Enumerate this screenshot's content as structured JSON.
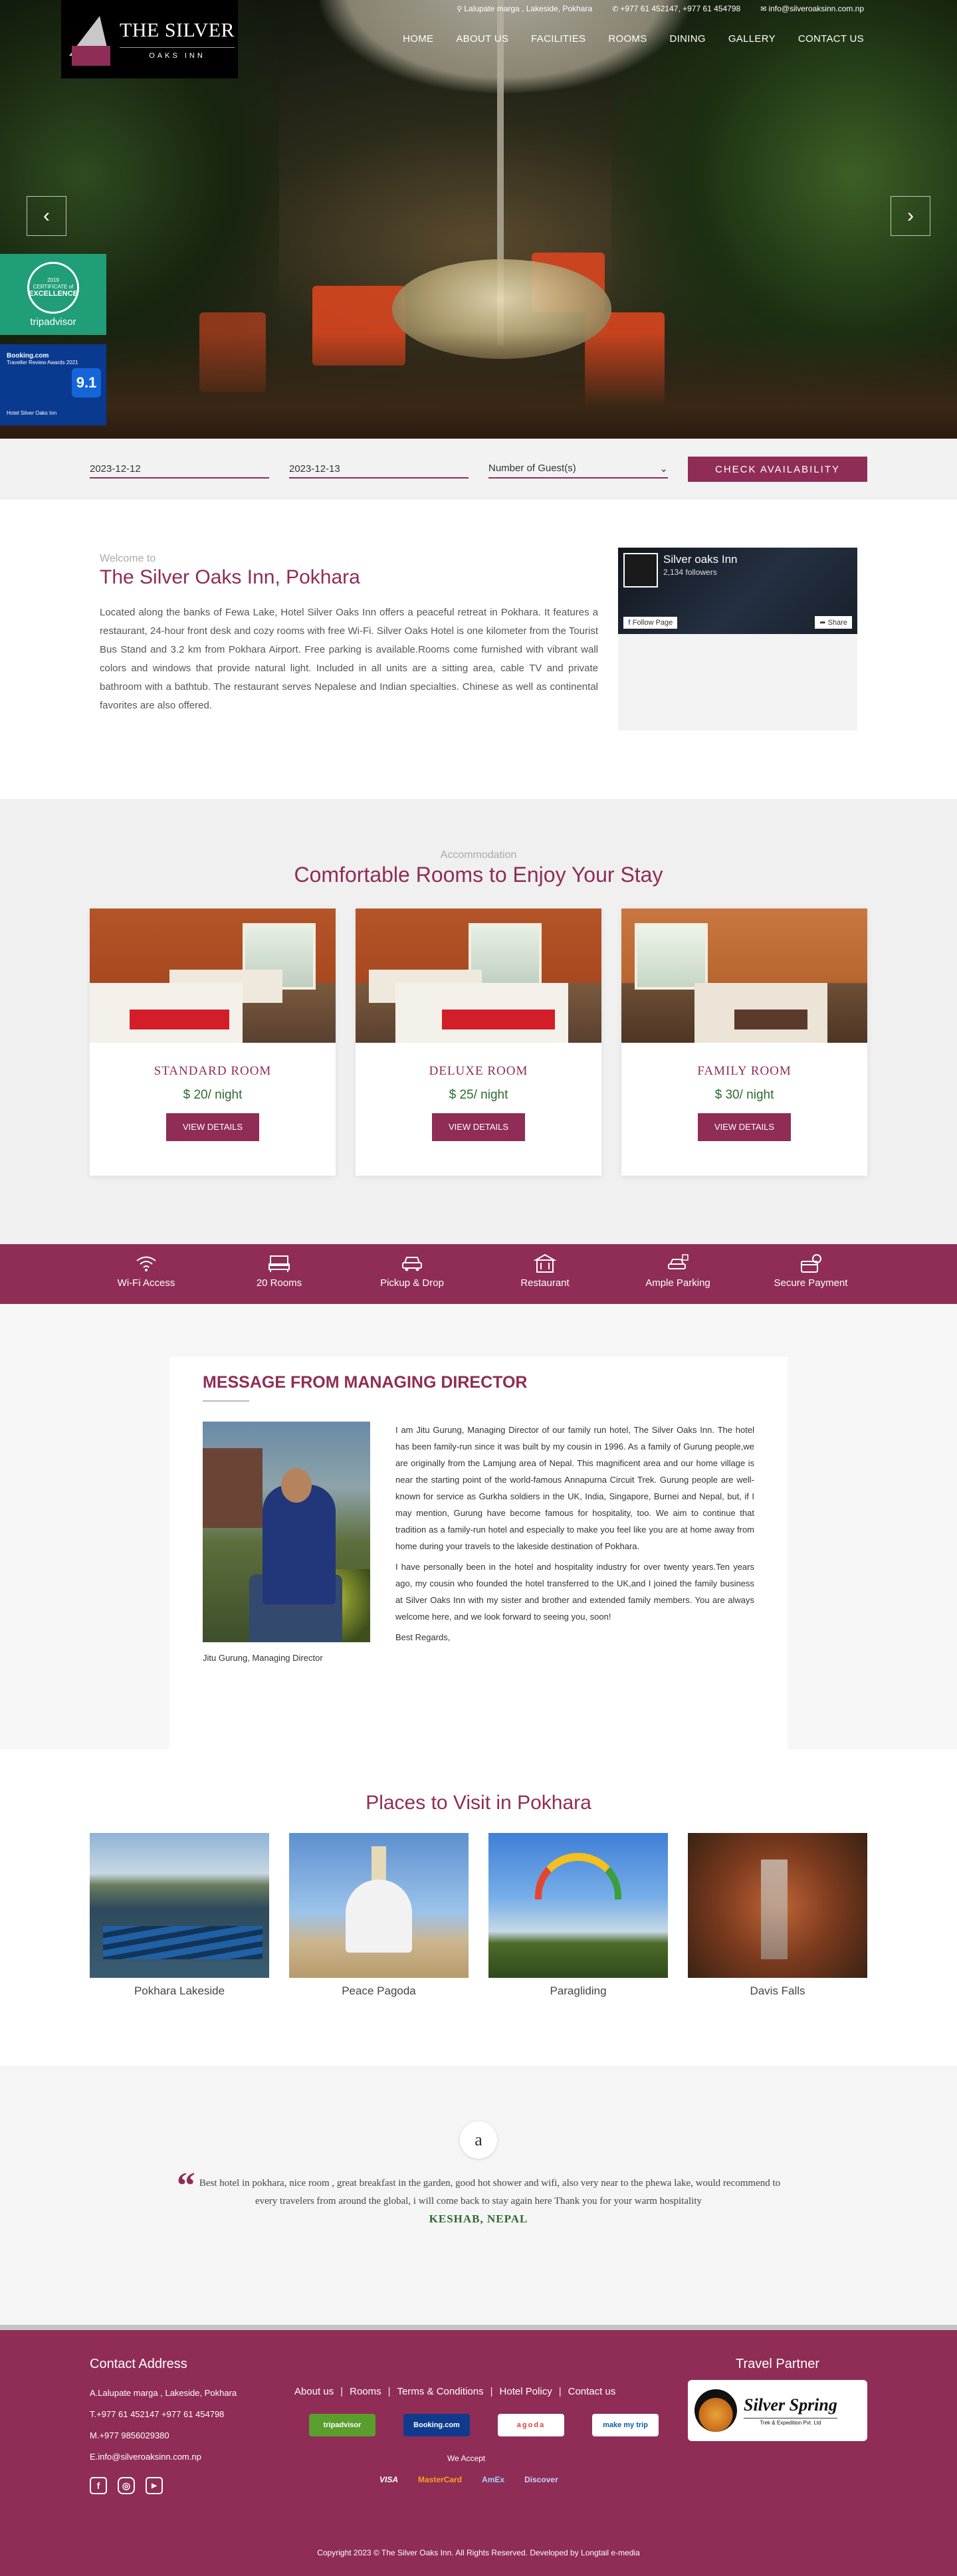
{
  "header": {
    "logo": {
      "line1": "THE SILVER",
      "line2": "OAKS INN"
    },
    "address": "Lalupate marga , Lakeside, Pokhara",
    "phone": "+977 61 452147, +977 61 454798",
    "email": "info@silveroaksinn.com.np",
    "nav": [
      "HOME",
      "ABOUT US",
      "FACILITIES",
      "ROOMS",
      "DINING",
      "GALLERY",
      "CONTACT US"
    ],
    "tripadvisor_badge": {
      "year": "2019",
      "line1": "CERTIFICATE of",
      "line2": "EXCELLENCE",
      "brand": "tripadvisor"
    },
    "booking_badge": {
      "brand": "Booking.com",
      "line1": "Traveller Review Awards 2021",
      "score": "9.1",
      "name": "Hotel Silver Oaks Inn"
    }
  },
  "booking": {
    "checkin": "2023-12-12",
    "checkout": "2023-12-13",
    "guests_placeholder": "Number of Guest(s)",
    "button": "CHECK AVAILABILITY"
  },
  "welcome": {
    "eyebrow": "Welcome to",
    "title": "The Silver Oaks Inn, Pokhara",
    "text": "Located along the banks of Fewa Lake, Hotel Silver Oaks Inn offers a peaceful retreat in Pokhara. It features a restaurant, 24-hour front desk and cozy rooms with free Wi-Fi. Silver Oaks Hotel is one kilometer from the Tourist Bus Stand and 3.2 km from Pokhara Airport. Free parking is available.Rooms come furnished with vibrant wall colors and windows that provide natural light. Included in all units are a sitting area, cable TV and private bathroom with a bathtub. The restaurant serves Nepalese and Indian specialties. Chinese as well as continental favorites are also offered.",
    "facebook": {
      "name": "Silver oaks Inn",
      "followers": "2,134 followers",
      "follow": "Follow Page",
      "share": "Share"
    }
  },
  "rooms": {
    "eyebrow": "Accommodation",
    "title": "Comfortable Rooms to Enjoy Your Stay",
    "items": [
      {
        "name": "STANDARD ROOM",
        "price": "$ 20/ night",
        "button": "VIEW DETAILS"
      },
      {
        "name": "DELUXE ROOM",
        "price": "$ 25/ night",
        "button": "VIEW DETAILS"
      },
      {
        "name": "FAMILY ROOM",
        "price": "$ 30/ night",
        "button": "VIEW DETAILS"
      }
    ]
  },
  "amenities": [
    {
      "label": "Wi-Fi Access",
      "icon": "wifi-icon"
    },
    {
      "label": "20 Rooms",
      "icon": "bed-icon"
    },
    {
      "label": "Pickup & Drop",
      "icon": "car-icon"
    },
    {
      "label": "Restaurant",
      "icon": "restaurant-icon"
    },
    {
      "label": "Ample Parking",
      "icon": "parking-icon"
    },
    {
      "label": "Secure Payment",
      "icon": "payment-icon"
    }
  ],
  "director": {
    "title": "MESSAGE FROM MANAGING DIRECTOR",
    "para1": "I am Jitu Gurung, Managing Director of our family run hotel, The Silver Oaks Inn. The hotel has been family-run since it was built by my cousin in 1996. As a family of Gurung people,we are originally from the Lamjung area of Nepal. This magnificent area and our home village is near the starting point of the world-famous Annapurna Circuit Trek. Gurung people are well-known for service as Gurkha soldiers in the UK, India, Singapore, Burnei and Nepal, but, if I may mention, Gurung have become famous for hospitality, too. We aim to continue that tradition as a family-run hotel and especially to make you feel like you are at home away from home during your travels to the lakeside destination of Pokhara.",
    "para2": "I have personally been in the hotel and hospitality industry for over twenty years.Ten years ago, my cousin who founded the hotel transferred to the UK,and I joined the family business at Silver Oaks Inn with my sister and brother and extended family members. You are always welcome here, and we look forward to seeing you, soon!",
    "regards": "Best Regards,",
    "signature": "Jitu Gurung, Managing Director"
  },
  "places": {
    "title": "Places to Visit in Pokhara",
    "items": [
      "Pokhara Lakeside",
      "Peace Pagoda",
      "Paragliding",
      "Davis Falls"
    ]
  },
  "testimonial": {
    "icon_letter": "a",
    "quote": "Best hotel in pokhara, nice room , great breakfast in the garden, good hot shower and wifi, also very near to the phewa lake, would recommend to every travelers from around the global, i will come back to stay again here Thank you for your warm hospitality",
    "author": "KESHAB, NEPAL"
  },
  "footer": {
    "contact_title": "Contact Address",
    "address": "A.Lalupate marga , Lakeside, Pokhara",
    "telephone": "T.+977 61 452147 +977 61 454798",
    "mobile": "M.+977 9856029380",
    "email": "E.info@silveroaksinn.com.np",
    "links": [
      "About us",
      "Rooms",
      "Terms & Conditions",
      "Hotel Policy",
      "Contact us"
    ],
    "partners": [
      "tripadvisor",
      "Booking.com",
      "agoda",
      "make my trip"
    ],
    "accept_label": "We Accept",
    "cards": [
      "VISA",
      "MasterCard",
      "AmEx",
      "Discover"
    ],
    "travel_title": "Travel Partner",
    "travel_partner": "Silver Spring",
    "travel_partner_sub": "Trek & Expedition Pvt. Ltd",
    "copyright": "Copyright 2023 © The Silver Oaks Inn. All Rights Reserved. Developed by Longtail e-media"
  },
  "colors": {
    "accent": "#8f2d56",
    "price": "#2d6b2e"
  }
}
